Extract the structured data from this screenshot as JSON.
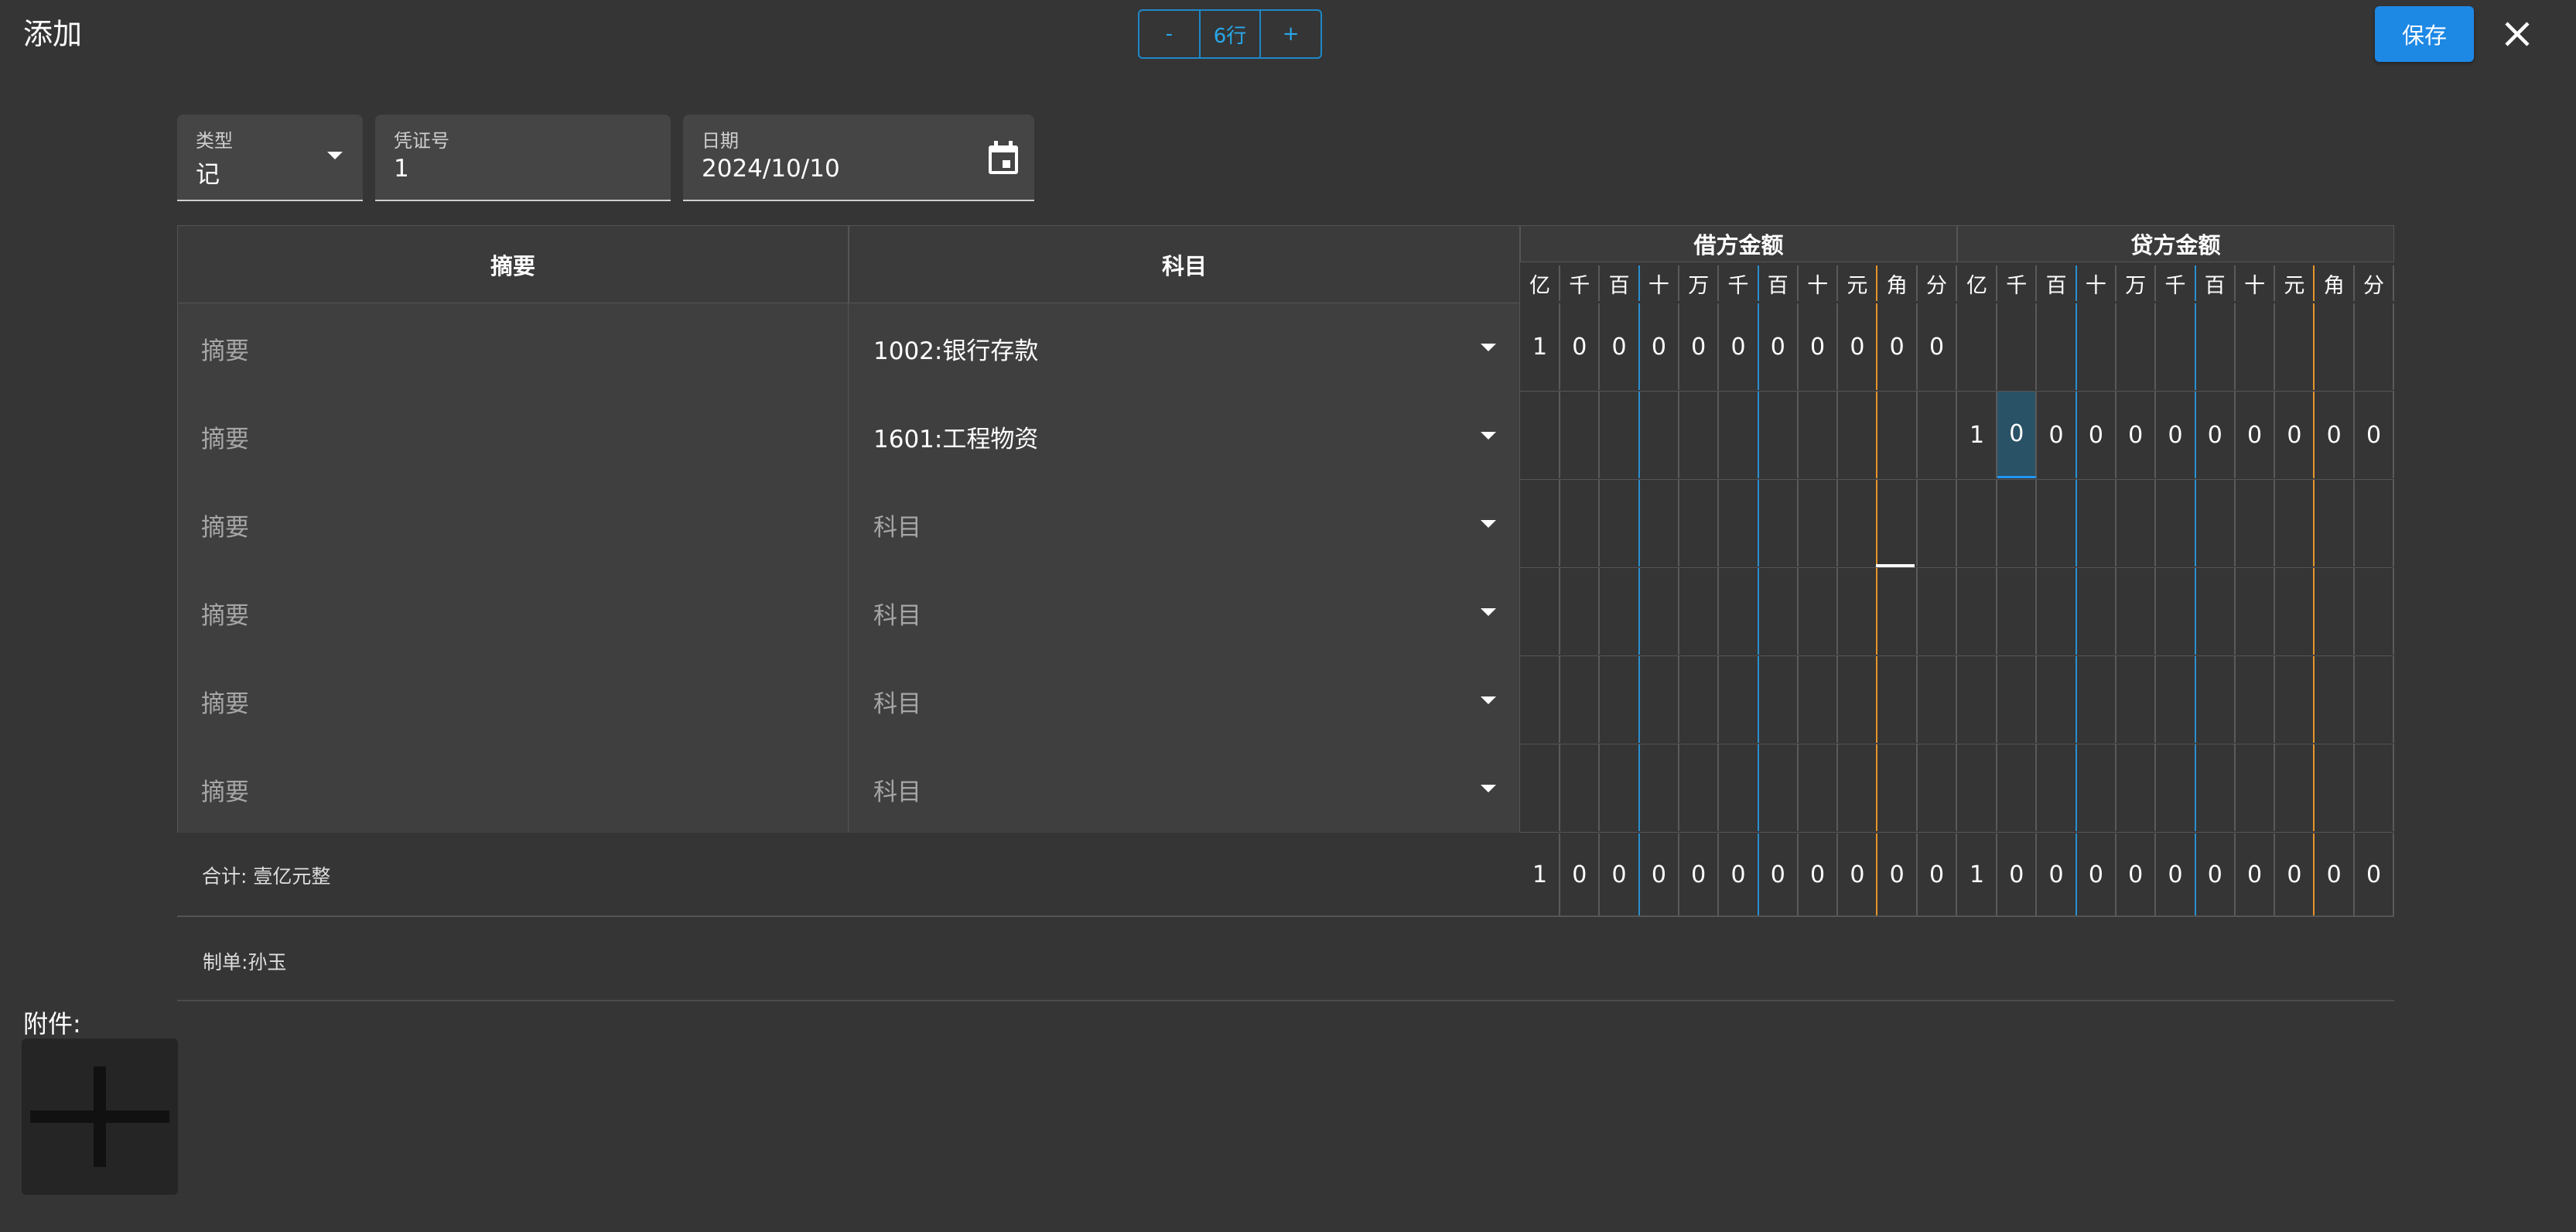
{
  "dialog": {
    "title": "添加",
    "rows_minus": "-",
    "rows_label": "6行",
    "rows_plus": "+",
    "save_label": "保存",
    "close_icon": "close-icon"
  },
  "form": {
    "type_label": "类型",
    "type_value": "记",
    "voucher_no_label": "凭证号",
    "voucher_no_value": "1",
    "date_label": "日期",
    "date_value": "2024/10/10",
    "date_icon": "calendar-icon"
  },
  "table": {
    "col_summary": "摘要",
    "col_account": "科目",
    "col_debit": "借方金额",
    "col_credit": "贷方金额",
    "digit_headers": [
      "亿",
      "千",
      "百",
      "十",
      "万",
      "千",
      "百",
      "十",
      "元",
      "角",
      "分"
    ],
    "summary_placeholder": "摘要",
    "rows": [
      {
        "summary": "",
        "account": "1002:银行存款",
        "account_placeholder": "科目",
        "debit": [
          "1",
          "0",
          "0",
          "0",
          "0",
          "0",
          "0",
          "0",
          "0",
          "0",
          "0"
        ],
        "credit": [
          "",
          "",
          "",
          "",
          "",
          "",
          "",
          "",
          "",
          "",
          ""
        ]
      },
      {
        "summary": "",
        "account": "1601:工程物资",
        "account_placeholder": "科目",
        "debit": [
          "",
          "",
          "",
          "",
          "",
          "",
          "",
          "",
          "",
          "",
          ""
        ],
        "credit": [
          "1",
          "0",
          "0",
          "0",
          "0",
          "0",
          "0",
          "0",
          "0",
          "0",
          "0"
        ]
      },
      {
        "summary": "",
        "account": "",
        "account_placeholder": "科目",
        "debit": [
          "",
          "",
          "",
          "",
          "",
          "",
          "",
          "",
          "",
          "",
          ""
        ],
        "credit": [
          "",
          "",
          "",
          "",
          "",
          "",
          "",
          "",
          "",
          "",
          ""
        ]
      },
      {
        "summary": "",
        "account": "",
        "account_placeholder": "科目",
        "debit": [
          "",
          "",
          "",
          "",
          "",
          "",
          "",
          "",
          "",
          "",
          ""
        ],
        "credit": [
          "",
          "",
          "",
          "",
          "",
          "",
          "",
          "",
          "",
          "",
          ""
        ]
      },
      {
        "summary": "",
        "account": "",
        "account_placeholder": "科目",
        "debit": [
          "",
          "",
          "",
          "",
          "",
          "",
          "",
          "",
          "",
          "",
          ""
        ],
        "credit": [
          "",
          "",
          "",
          "",
          "",
          "",
          "",
          "",
          "",
          "",
          ""
        ]
      },
      {
        "summary": "",
        "account": "",
        "account_placeholder": "科目",
        "debit": [
          "",
          "",
          "",
          "",
          "",
          "",
          "",
          "",
          "",
          "",
          ""
        ],
        "credit": [
          "",
          "",
          "",
          "",
          "",
          "",
          "",
          "",
          "",
          "",
          ""
        ]
      }
    ],
    "total_label": "合计: 壹亿元整",
    "total_debit": [
      "1",
      "0",
      "0",
      "0",
      "0",
      "0",
      "0",
      "0",
      "0",
      "0",
      "0"
    ],
    "total_credit": [
      "1",
      "0",
      "0",
      "0",
      "0",
      "0",
      "0",
      "0",
      "0",
      "0",
      "0"
    ]
  },
  "footer": {
    "maker": "制单:孙玉",
    "attach_label": "附件:",
    "attach_add_icon": "plus-icon"
  },
  "colors": {
    "accent": "#1e88e5",
    "accent_text": "#29a8ea",
    "divider_blue": "#2a8fd0",
    "divider_orange": "#e8952a",
    "background": "#353535"
  }
}
